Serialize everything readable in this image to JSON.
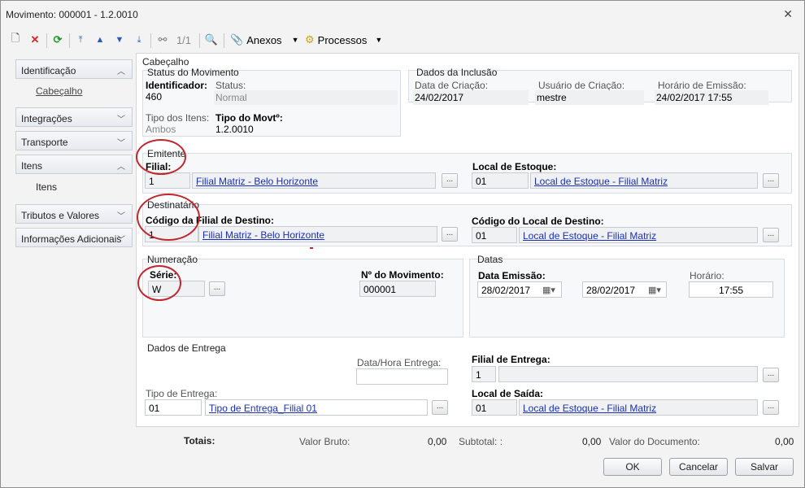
{
  "window": {
    "title": "Movimento: 000001 - 1.2.0010"
  },
  "toolbar": {
    "paging": "1/1",
    "anexos_label": "Anexos",
    "processos_label": "Processos"
  },
  "sidebar": {
    "items": [
      {
        "label": "Identificação",
        "chevron": "^"
      },
      {
        "label": "Integrações",
        "chevron": "v"
      },
      {
        "label": "Transporte",
        "chevron": "v"
      },
      {
        "label": "Itens",
        "chevron": "^"
      },
      {
        "label": "Tributos e Valores",
        "chevron": "v"
      },
      {
        "label": "Informações Adicionais",
        "chevron": "v"
      }
    ],
    "sub_cabecalho": "Cabeçalho",
    "sub_itens": "Itens"
  },
  "cabecalho": {
    "section_title": "Cabeçalho",
    "status_title": "Status do Movimento",
    "identificador_label": "Identificador:",
    "identificador_value": "460",
    "status_label": "Status:",
    "status_value": "Normal",
    "tipo_itens_label": "Tipo dos Itens:",
    "tipo_itens_value": "Ambos",
    "tipo_movto_label": "Tipo do Movtº:",
    "tipo_movto_value": "1.2.0010",
    "inclusao_title": "Dados da Inclusão",
    "data_criacao_label": "Data de Criação:",
    "data_criacao_value": "24/02/2017",
    "usuario_label": "Usuário de Criação:",
    "usuario_value": "mestre",
    "horario_emissao_label": "Horário de Emissão:",
    "horario_emissao_value": "24/02/2017 17:55"
  },
  "emitente": {
    "title": "Emitente",
    "filial_label": "Filial:",
    "filial_code": "1",
    "filial_name": "Filial Matriz - Belo Horizonte",
    "local_label": "Local de Estoque:",
    "local_code": "01",
    "local_name": "Local de Estoque - Filial Matriz"
  },
  "destinatario": {
    "title": "Destinatário",
    "filial_label": "Código da Filial de Destino:",
    "filial_code": "1",
    "filial_name": "Filial Matriz - Belo Horizonte",
    "local_label": "Código do Local de Destino:",
    "local_code": "01",
    "local_name": "Local de Estoque - Filial Matriz"
  },
  "numeracao": {
    "title": "Numeração",
    "serie_label": "Série:",
    "serie_value": "W",
    "numero_label": "Nº do Movimento:",
    "numero_value": "000001"
  },
  "datas": {
    "title": "Datas",
    "emissao_label": "Data Emissão:",
    "emissao_value": "28/02/2017",
    "second_date_value": "28/02/2017",
    "horario_label": "Horário:",
    "horario_value": "17:55"
  },
  "entrega": {
    "title": "Dados de Entrega",
    "data_hora_label": "Data/Hora Entrega:",
    "tipo_label": "Tipo de Entrega:",
    "tipo_code": "01",
    "tipo_name": "Tipo de Entrega_Filial 01",
    "filial_label": "Filial de Entrega:",
    "filial_code": "1",
    "saida_label": "Local de Saída:",
    "saida_code": "01",
    "saida_name": "Local de Estoque - Filial Matriz"
  },
  "totais": {
    "label": "Totais:",
    "valor_bruto_label": "Valor Bruto:",
    "valor_bruto_value": "0,00",
    "subtotal_label": "Subtotal: :",
    "subtotal_value": "0,00",
    "valor_doc_label": "Valor do Documento:",
    "valor_doc_value": "0,00"
  },
  "buttons": {
    "ok": "OK",
    "cancelar": "Cancelar",
    "salvar": "Salvar"
  },
  "colors": {
    "link": "#1a2fb5",
    "annotation": "#c0262d"
  }
}
